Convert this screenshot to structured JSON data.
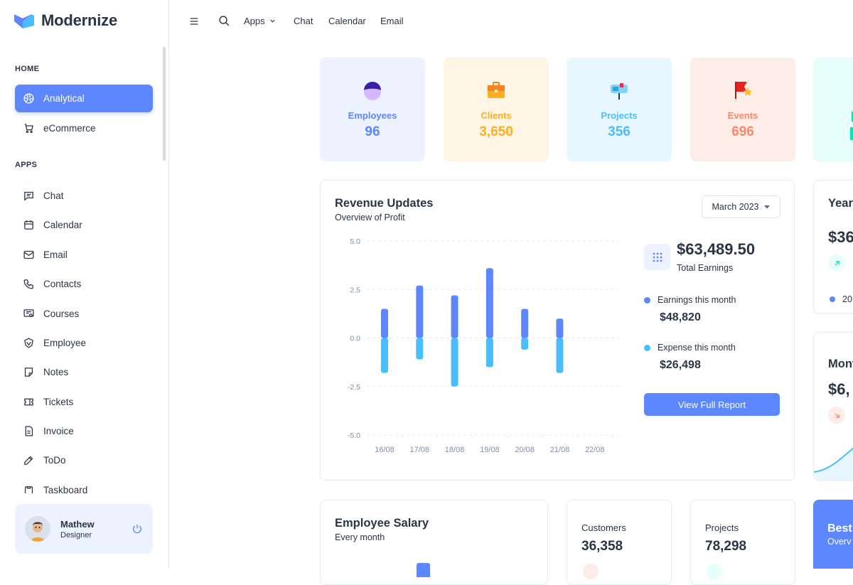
{
  "app": {
    "name": "Modernize"
  },
  "sidebar": {
    "sections": [
      {
        "caption": "HOME"
      },
      {
        "caption": "APPS"
      }
    ],
    "home_items": [
      {
        "label": "Analytical"
      },
      {
        "label": "eCommerce"
      }
    ],
    "app_items": [
      {
        "label": "Chat"
      },
      {
        "label": "Calendar"
      },
      {
        "label": "Email"
      },
      {
        "label": "Contacts"
      },
      {
        "label": "Courses"
      },
      {
        "label": "Employee"
      },
      {
        "label": "Notes"
      },
      {
        "label": "Tickets"
      },
      {
        "label": "Invoice"
      },
      {
        "label": "ToDo"
      },
      {
        "label": "Taskboard"
      }
    ],
    "profile": {
      "name": "Mathew",
      "role": "Designer"
    }
  },
  "topbar": {
    "apps": "Apps",
    "chat": "Chat",
    "calendar": "Calendar",
    "email": "Email"
  },
  "stats": [
    {
      "label": "Employees",
      "value": "96",
      "bg": "#ecf2ff",
      "color": "#5d87ff"
    },
    {
      "label": "Clients",
      "value": "3,650",
      "bg": "#fef5e5",
      "color": "#ffae1f"
    },
    {
      "label": "Projects",
      "value": "356",
      "bg": "#e8f7ff",
      "color": "#49beff"
    },
    {
      "label": "Events",
      "value": "696",
      "bg": "#fdede8",
      "color": "#fa896b"
    }
  ],
  "revenue": {
    "title": "Revenue Updates",
    "subtitle": "Overview of Profit",
    "period": "March 2023",
    "total": "$63,489.50",
    "total_label": "Total Earnings",
    "earnings_label": "Earnings this month",
    "earnings_value": "$48,820",
    "expense_label": "Expense this month",
    "expense_value": "$26,498",
    "button": "View Full Report"
  },
  "chart_data": {
    "type": "bar",
    "categories": [
      "16/08",
      "17/08",
      "18/08",
      "19/08",
      "20/08",
      "21/08",
      "22/08"
    ],
    "series": [
      {
        "name": "Earnings this month",
        "values": [
          1.5,
          2.7,
          2.2,
          3.6,
          1.5,
          1.0,
          0
        ],
        "color": "#5d87ff"
      },
      {
        "name": "Expense this month",
        "values": [
          -1.8,
          -1.1,
          -2.5,
          -1.5,
          -0.6,
          -1.8,
          0
        ],
        "color": "#49beff"
      }
    ],
    "yticks": [
      "5.0",
      "2.5",
      "0.0",
      "-2.5",
      "-5.0"
    ],
    "ylim": [
      -5,
      5
    ],
    "grid": true
  },
  "partial": {
    "yearly_title": "Yearl",
    "yearly_value": "$36",
    "yearly_legend": "20",
    "monthly_title": "Mont",
    "monthly_value": "$6,",
    "best_title": "Best",
    "best_sub": "Overv"
  },
  "salary": {
    "title": "Employee Salary",
    "subtitle": "Every month"
  },
  "customers": {
    "label": "Customers",
    "value": "36,358"
  },
  "projects2": {
    "label": "Projects",
    "value": "78,298"
  }
}
